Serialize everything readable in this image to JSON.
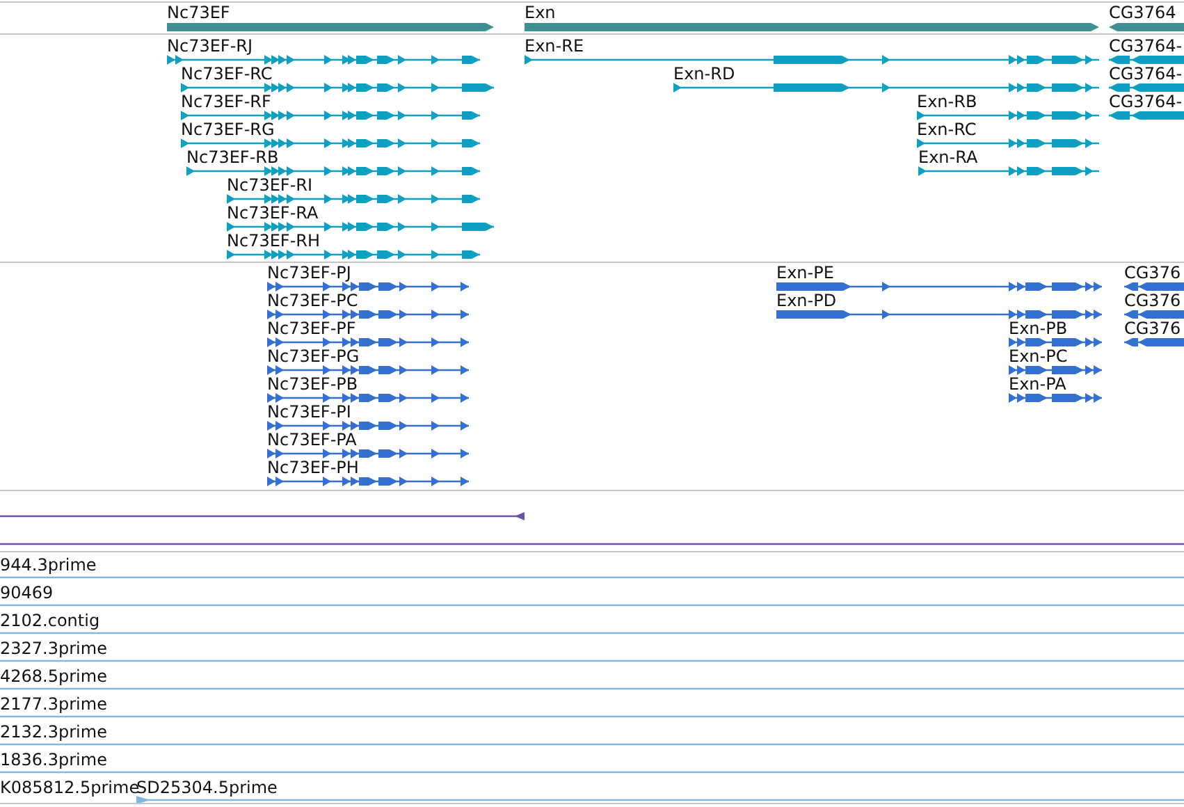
{
  "gene_track": {
    "genes": [
      {
        "label": "Nc73EF",
        "reverse": false
      },
      {
        "label": "Exn",
        "reverse": false
      },
      {
        "label": "CG3764",
        "reverse": true
      }
    ]
  },
  "transcript_track": {
    "transcripts": [
      {
        "label": "Nc73EF-RJ",
        "reverse": false
      },
      {
        "label": "Nc73EF-RC",
        "reverse": false
      },
      {
        "label": "Nc73EF-RF",
        "reverse": false
      },
      {
        "label": "Nc73EF-RG",
        "reverse": false
      },
      {
        "label": "Nc73EF-RB",
        "reverse": false
      },
      {
        "label": "Nc73EF-RI",
        "reverse": false
      },
      {
        "label": "Nc73EF-RA",
        "reverse": false
      },
      {
        "label": "Nc73EF-RH",
        "reverse": false
      },
      {
        "label": "Exn-RE",
        "reverse": false
      },
      {
        "label": "Exn-RD",
        "reverse": false
      },
      {
        "label": "Exn-RB",
        "reverse": false
      },
      {
        "label": "Exn-RC",
        "reverse": false
      },
      {
        "label": "Exn-RA",
        "reverse": false
      },
      {
        "label": "CG3764-",
        "reverse": true
      },
      {
        "label": "CG3764-",
        "reverse": true
      },
      {
        "label": "CG3764-",
        "reverse": true
      }
    ]
  },
  "protein_track": {
    "proteins": [
      {
        "label": "Nc73EF-PJ",
        "reverse": false
      },
      {
        "label": "Nc73EF-PC",
        "reverse": false
      },
      {
        "label": "Nc73EF-PF",
        "reverse": false
      },
      {
        "label": "Nc73EF-PG",
        "reverse": false
      },
      {
        "label": "Nc73EF-PB",
        "reverse": false
      },
      {
        "label": "Nc73EF-PI",
        "reverse": false
      },
      {
        "label": "Nc73EF-PA",
        "reverse": false
      },
      {
        "label": "Nc73EF-PH",
        "reverse": false
      },
      {
        "label": "Exn-PE",
        "reverse": false
      },
      {
        "label": "Exn-PD",
        "reverse": false
      },
      {
        "label": "Exn-PB",
        "reverse": false
      },
      {
        "label": "Exn-PC",
        "reverse": false
      },
      {
        "label": "Exn-PA",
        "reverse": false
      },
      {
        "label": "CG376",
        "reverse": true
      },
      {
        "label": "CG376",
        "reverse": true
      },
      {
        "label": "CG376",
        "reverse": true
      }
    ]
  },
  "est_track": {
    "rows": [
      {
        "labels": [
          "944.3prime"
        ]
      },
      {
        "labels": [
          "90469"
        ]
      },
      {
        "labels": [
          "2102.contig"
        ]
      },
      {
        "labels": [
          "2327.3prime"
        ]
      },
      {
        "labels": [
          "4268.5prime"
        ]
      },
      {
        "labels": [
          "2177.3prime"
        ]
      },
      {
        "labels": [
          "2132.3prime"
        ]
      },
      {
        "labels": [
          "1836.3prime"
        ]
      },
      {
        "labels": [
          "K085812.5prime",
          "SD25304.5prime"
        ]
      }
    ]
  }
}
